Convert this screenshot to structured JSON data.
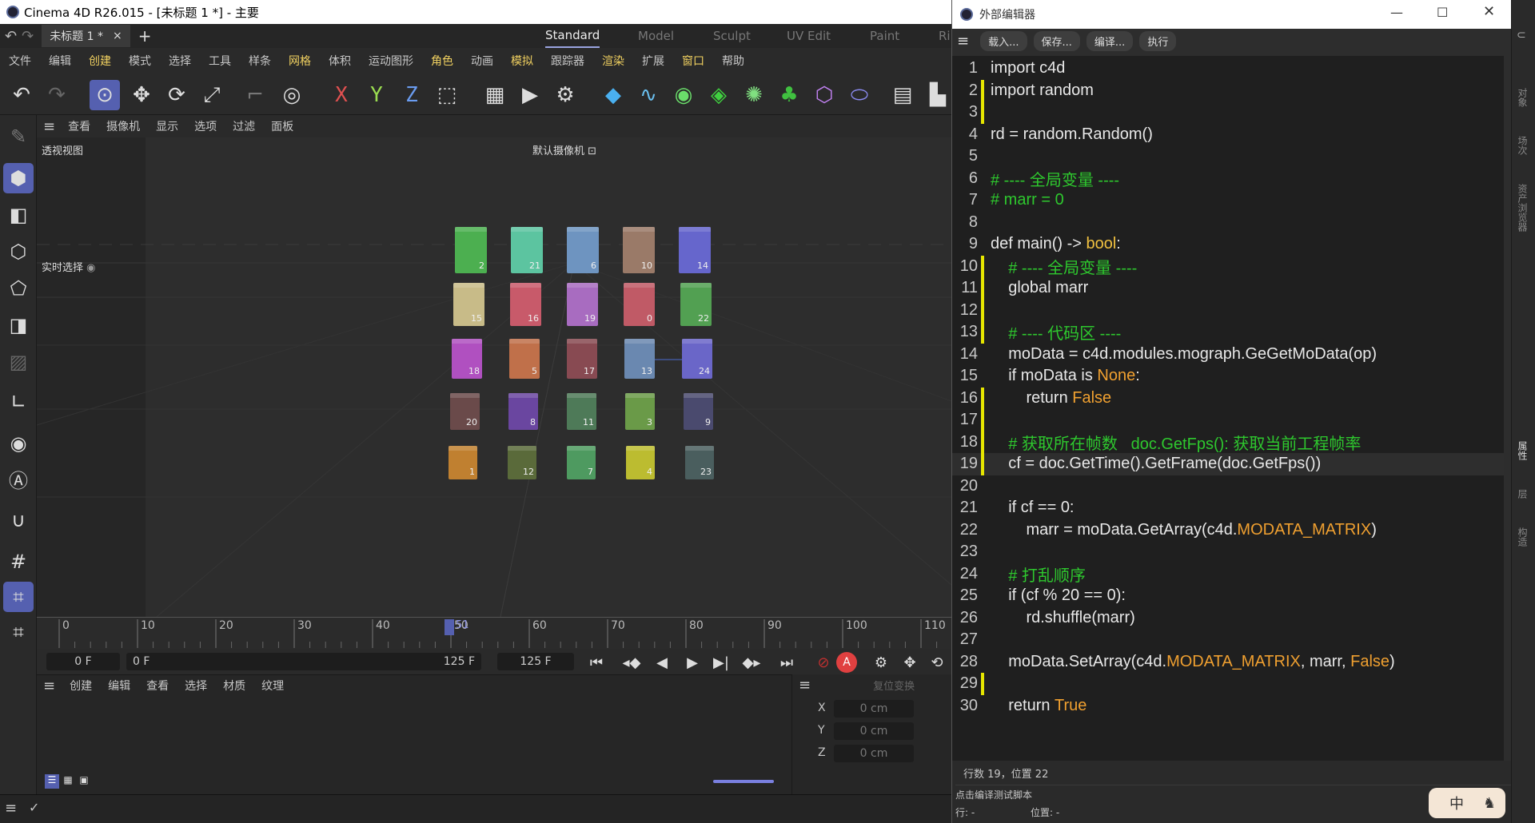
{
  "app": {
    "title": "Cinema 4D R26.015 - [未标题 1 *] - 主要",
    "doc_tab": "未标题 1 *",
    "layouts": [
      "Standard",
      "Model",
      "Sculpt",
      "UV Edit",
      "Paint",
      "Ri"
    ],
    "menu": [
      "文件",
      "编辑",
      "创建",
      "模式",
      "选择",
      "工具",
      "样条",
      "网格",
      "体积",
      "运动图形",
      "角色",
      "动画",
      "模拟",
      "跟踪器",
      "渲染",
      "扩展",
      "窗口",
      "帮助"
    ],
    "viewport_menu": [
      "查看",
      "摄像机",
      "显示",
      "选项",
      "过滤",
      "面板"
    ],
    "viewport_label": "透视视图",
    "camera_label": "默认摄像机",
    "realtime_select": "实时选择"
  },
  "cubes": [
    {
      "n": "2",
      "c": "#4caf50"
    },
    {
      "n": "21",
      "c": "#5cc4a0"
    },
    {
      "n": "6",
      "c": "#6e94c0"
    },
    {
      "n": "10",
      "c": "#9a7a68"
    },
    {
      "n": "14",
      "c": "#6666cc"
    },
    {
      "n": "15",
      "c": "#c8bb88"
    },
    {
      "n": "16",
      "c": "#c85a6a"
    },
    {
      "n": "19",
      "c": "#a86cc0"
    },
    {
      "n": "0",
      "c": "#c05a66"
    },
    {
      "n": "22",
      "c": "#52a052"
    },
    {
      "n": "18",
      "c": "#b050c0"
    },
    {
      "n": "5",
      "c": "#c0704a"
    },
    {
      "n": "17",
      "c": "#884a52"
    },
    {
      "n": "13",
      "c": "#6a88b0"
    },
    {
      "n": "24",
      "c": "#6a66c8"
    },
    {
      "n": "20",
      "c": "#6a4a4a"
    },
    {
      "n": "8",
      "c": "#6a46a0"
    },
    {
      "n": "11",
      "c": "#4e7a58"
    },
    {
      "n": "3",
      "c": "#6a9a48"
    },
    {
      "n": "9",
      "c": "#4a4a6e"
    },
    {
      "n": "1",
      "c": "#c08030"
    },
    {
      "n": "12",
      "c": "#5a6a3a"
    },
    {
      "n": "7",
      "c": "#4e9a60"
    },
    {
      "n": "4",
      "c": "#bcbc30"
    },
    {
      "n": "23",
      "c": "#4a5e5e"
    }
  ],
  "timeline": {
    "ticks": [
      "0",
      "10",
      "20",
      "30",
      "40",
      "50",
      "60",
      "70",
      "80",
      "90",
      "100",
      "110"
    ],
    "current": "51"
  },
  "transport": {
    "start": "0 F",
    "range_start": "0 F",
    "range_end": "125 F",
    "end": "125 F"
  },
  "material_menu": [
    "创建",
    "编辑",
    "查看",
    "选择",
    "材质",
    "纹理"
  ],
  "coords": {
    "header": "复位变换",
    "rows": [
      {
        "axis": "X",
        "val": "0 cm"
      },
      {
        "axis": "Y",
        "val": "0 cm"
      },
      {
        "axis": "Z",
        "val": "0 cm"
      }
    ]
  },
  "editor": {
    "title": "外部编辑器",
    "buttons": [
      "载入...",
      "保存...",
      "编译...",
      "执行"
    ],
    "status_pos": "行数 19，位置 22",
    "status_hint": "点击编译测试脚本",
    "footer_line": "行: -",
    "footer_pos": "位置: -",
    "ime": "中"
  },
  "right_tabs": [
    "对象",
    "场次",
    "资产浏览器",
    "属性",
    "层",
    "构造"
  ],
  "code": [
    {
      "n": "1",
      "t": "import c4d",
      "m": ""
    },
    {
      "n": "2",
      "t": "import random",
      "m": "y"
    },
    {
      "n": "3",
      "t": "",
      "m": "y"
    },
    {
      "n": "4",
      "t": "rd = random.Random()",
      "m": ""
    },
    {
      "n": "5",
      "t": "",
      "m": ""
    },
    {
      "n": "6",
      "t": "# ---- 全局变量 ----",
      "m": "",
      "cls": "cm"
    },
    {
      "n": "7",
      "t": "# marr = 0",
      "m": "",
      "cls": "cm"
    },
    {
      "n": "8",
      "t": "",
      "m": ""
    },
    {
      "n": "9",
      "t": "def main() -> bool:",
      "m": ""
    },
    {
      "n": "10",
      "t": "    # ---- 全局变量 ----",
      "m": "y",
      "cls": "cm"
    },
    {
      "n": "11",
      "t": "    global marr",
      "m": "y"
    },
    {
      "n": "12",
      "t": "",
      "m": "y"
    },
    {
      "n": "13",
      "t": "    # ---- 代码区 ----",
      "m": "y",
      "cls": "cm"
    },
    {
      "n": "14",
      "t": "    moData = c4d.modules.mograph.GeGetMoData(op)",
      "m": ""
    },
    {
      "n": "15",
      "t": "    if moData is None:",
      "m": ""
    },
    {
      "n": "16",
      "t": "        return False",
      "m": "y"
    },
    {
      "n": "17",
      "t": "",
      "m": "y"
    },
    {
      "n": "18",
      "t": "    # 获取所在帧数   doc.GetFps(): 获取当前工程帧率",
      "m": "y",
      "cls": "cm"
    },
    {
      "n": "19",
      "t": "    cf = doc.GetTime().GetFrame(doc.GetFps())",
      "m": "y",
      "hl": true
    },
    {
      "n": "20",
      "t": "",
      "m": ""
    },
    {
      "n": "21",
      "t": "    if cf == 0:",
      "m": ""
    },
    {
      "n": "22",
      "t": "        marr = moData.GetArray(c4d.MODATA_MATRIX)",
      "m": ""
    },
    {
      "n": "23",
      "t": "",
      "m": ""
    },
    {
      "n": "24",
      "t": "    # 打乱顺序",
      "m": "",
      "cls": "cm"
    },
    {
      "n": "25",
      "t": "    if (cf % 20 == 0):",
      "m": ""
    },
    {
      "n": "26",
      "t": "        rd.shuffle(marr)",
      "m": ""
    },
    {
      "n": "27",
      "t": "",
      "m": ""
    },
    {
      "n": "28",
      "t": "    moData.SetArray(c4d.MODATA_MATRIX, marr, False)",
      "m": ""
    },
    {
      "n": "29",
      "t": "",
      "m": "y"
    },
    {
      "n": "30",
      "t": "    return True",
      "m": ""
    }
  ]
}
